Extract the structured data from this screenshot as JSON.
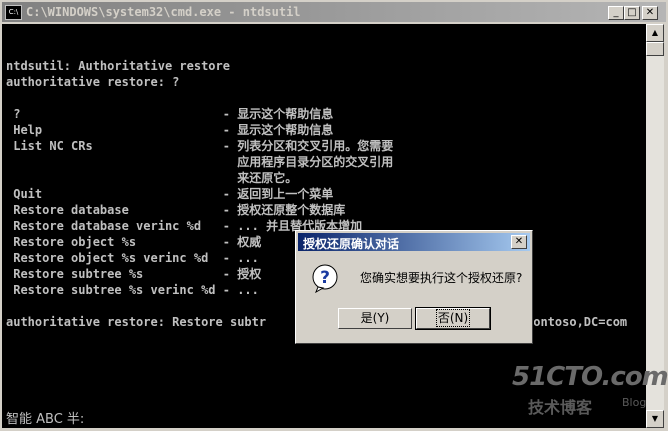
{
  "window": {
    "title": "C:\\WINDOWS\\system32\\cmd.exe - ntdsutil",
    "icon_label": "C:\\"
  },
  "console": {
    "lines": [
      "ntdsutil: Authoritative restore",
      "authoritative restore: ?",
      "",
      " ?                            - 显示这个帮助信息",
      " Help                         - 显示这个帮助信息",
      " List NC CRs                  - 列表分区和交叉引用。您需要",
      "                                应用程序目录分区的交叉引用",
      "                                来还原它。",
      " Quit                         - 返回到上一个菜单",
      " Restore database             - 授权还原整个数据库",
      " Restore database verinc %d   - ... 并且替代版本增加",
      " Restore object %s            - 权威",
      " Restore object %s verinc %d  - ...",
      " Restore subtree %s           - 授权",
      " Restore subtree %s verinc %d - ...",
      "",
      "authoritative restore: Restore subtr",
      "contoso,DC=com"
    ],
    "ime_status": "智能 ABC 半:"
  },
  "dialog": {
    "title": "授权还原确认对话",
    "message": "您确实想要执行这个授权还原?",
    "yes_label": "是(Y)",
    "no_label": "否(N)"
  },
  "watermark": {
    "line1": "51CTO.com",
    "line2": "技术博客",
    "line3": "Blog"
  },
  "colors": {
    "console_bg": "#000000",
    "console_fg": "#c0c0c0",
    "dialog_title": "#0a246a"
  }
}
